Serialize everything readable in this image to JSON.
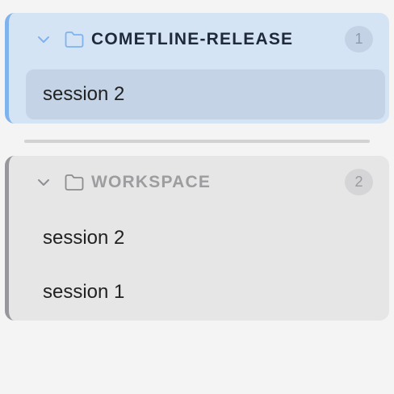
{
  "groups": [
    {
      "title": "COMETLINE-RELEASE",
      "count": "1",
      "state": "active",
      "accent_color": "#7fb3ee",
      "icons": [
        "chevron-down-icon",
        "folder-icon"
      ],
      "sessions": [
        {
          "label": "session 2",
          "selected": true
        }
      ]
    },
    {
      "title": "WORKSPACE",
      "count": "2",
      "state": "muted",
      "accent_color": "#98989c",
      "icons": [
        "chevron-down-icon",
        "folder-icon"
      ],
      "sessions": [
        {
          "label": "session 2",
          "selected": false
        },
        {
          "label": "session 1",
          "selected": false
        }
      ]
    }
  ]
}
